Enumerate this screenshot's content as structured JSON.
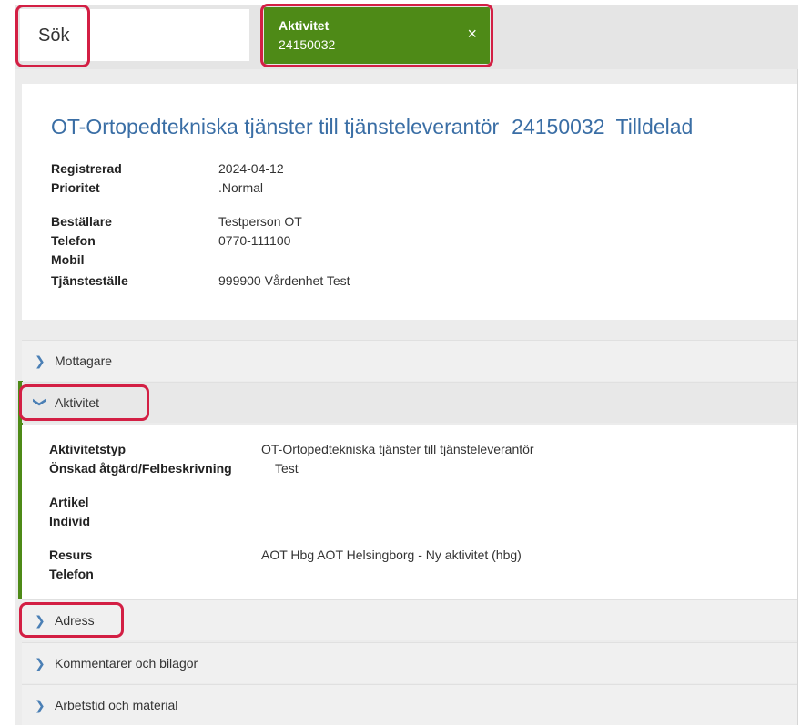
{
  "tabs": {
    "search_label": "Sök",
    "activity_title": "Aktivitet",
    "activity_number": "24150032",
    "close_glyph": "×"
  },
  "header": {
    "title": "OT-Ortopedtekniska tjänster till tjänsteleverantör",
    "number": "24150032",
    "status": "Tilldelad",
    "fields": [
      {
        "label": "Registrerad",
        "value": "2024-04-12"
      },
      {
        "label": "Prioritet",
        "value": ".Normal"
      },
      {
        "label": "Beställare",
        "value": "Testperson OT"
      },
      {
        "label": "Telefon",
        "value": "0770-111100"
      },
      {
        "label": "Mobil",
        "value": ""
      },
      {
        "label": "Tjänsteställe",
        "value": "999900 Vårdenhet Test"
      }
    ]
  },
  "sections": {
    "mottagare": "Mottagare",
    "aktivitet": "Aktivitet",
    "adress": "Adress",
    "kommentarer": "Kommentarer och bilagor",
    "arbetstid": "Arbetstid och material"
  },
  "activity": {
    "fields": [
      {
        "label": "Aktivitetstyp",
        "value": "OT-Ortopedtekniska tjänster till tjänsteleverantör"
      },
      {
        "label": "Önskad åtgärd/Felbeskrivning",
        "value": "Test"
      },
      {
        "label": "Artikel",
        "value": ""
      },
      {
        "label": "Individ",
        "value": ""
      },
      {
        "label": "Resurs",
        "value": "AOT Hbg AOT Helsingborg - Ny aktivitet (hbg)"
      },
      {
        "label": "Telefon",
        "value": ""
      }
    ]
  },
  "colors": {
    "accent_green": "#4e8a17",
    "title_blue": "#3a6ea5",
    "highlight_red": "#d31f44"
  },
  "icons": {
    "collapsed": "chevron-right-icon",
    "expanded": "chevron-down-icon",
    "close": "close-icon"
  }
}
